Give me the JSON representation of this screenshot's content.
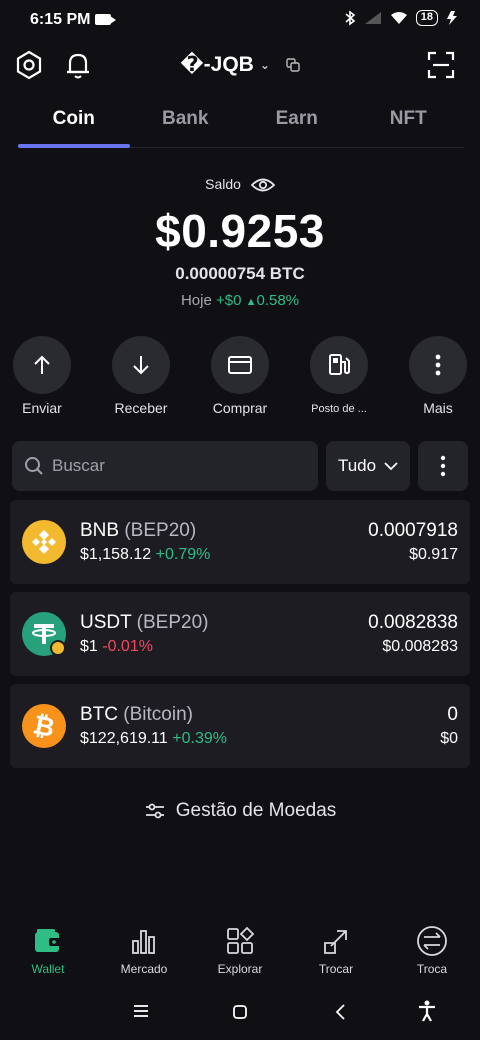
{
  "status": {
    "time": "6:15 PM",
    "battery": "18"
  },
  "header": {
    "account": "�-JQB"
  },
  "tabs": [
    {
      "label": "Coin",
      "active": true
    },
    {
      "label": "Bank"
    },
    {
      "label": "Earn"
    },
    {
      "label": "NFT"
    }
  ],
  "balance": {
    "label": "Saldo",
    "amount": "$0.9253",
    "btc": "0.00000754 BTC",
    "today_label": "Hoje",
    "today_change": "+$0",
    "today_pct": "0.58%"
  },
  "actions": [
    {
      "label": "Enviar",
      "icon": "arrow-up-icon"
    },
    {
      "label": "Receber",
      "icon": "arrow-down-icon"
    },
    {
      "label": "Comprar",
      "icon": "card-icon"
    },
    {
      "label": "Posto de ...",
      "icon": "fuel-icon"
    },
    {
      "label": "Mais",
      "icon": "more-vertical-icon"
    }
  ],
  "search": {
    "placeholder": "Buscar",
    "filter": "Tudo"
  },
  "coins": [
    {
      "symbol": "BNB",
      "network": "(BEP20)",
      "price": "$1,158.12",
      "change": "+0.79%",
      "qty": "0.0007918",
      "value": "$0.917",
      "color": "#f3ba2f"
    },
    {
      "symbol": "USDT",
      "network": "(BEP20)",
      "price": "$1",
      "change": "-0.01%",
      "qty": "0.0082838",
      "value": "$0.008283",
      "color": "#26a17b"
    },
    {
      "symbol": "BTC",
      "network": "(Bitcoin)",
      "price": "$122,619.11",
      "change": "+0.39%",
      "qty": "0",
      "value": "$0",
      "color": "#f7931a"
    }
  ],
  "manage": "Gestão de Moedas",
  "bottom_nav": [
    {
      "label": "Wallet",
      "active": true
    },
    {
      "label": "Mercado"
    },
    {
      "label": "Explorar"
    },
    {
      "label": "Trocar"
    },
    {
      "label": "Troca"
    }
  ],
  "colors": {
    "accent": "#6b74f0",
    "positive": "#2ebd85",
    "negative": "#f6465d"
  }
}
